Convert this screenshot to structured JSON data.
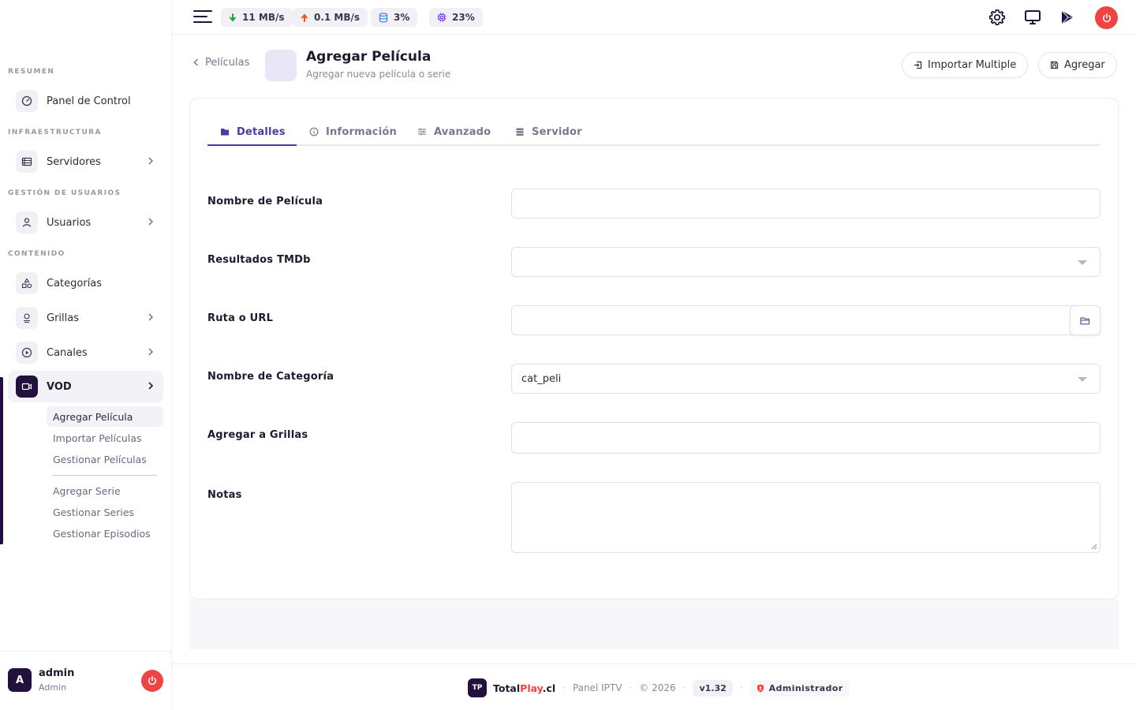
{
  "colors": {
    "primary": "#22113d",
    "accent": "#4a3aa8",
    "danger": "#ef4444",
    "highlight": "#ef4444"
  },
  "topbar": {
    "stats": [
      {
        "icon": "download-arrow-icon",
        "value": "11 MB/s",
        "color": "#16a34a"
      },
      {
        "icon": "upload-arrow-icon",
        "value": "0.1 MB/s",
        "color": "#ea580c"
      },
      {
        "icon": "database-icon",
        "value": "3%",
        "color": "#3b82f6"
      },
      {
        "icon": "cpu-icon",
        "value": "23%",
        "color": "#7c3aed"
      }
    ],
    "icons": [
      "gear-icon",
      "monitor-icon",
      "play-store-icon",
      "power-icon"
    ]
  },
  "sidebar": {
    "sections": [
      {
        "title": "RESUMEN"
      },
      {
        "title": "INFRAESTRUCTURA"
      },
      {
        "title": "GESTIÓN DE USUARIOS"
      },
      {
        "title": "CONTENIDO"
      }
    ],
    "items": [
      {
        "label": "Panel de Control",
        "icon": "dashboard-icon"
      },
      {
        "label": "Servidores",
        "icon": "server-icon"
      },
      {
        "label": "Usuarios",
        "icon": "user-icon"
      },
      {
        "label": "Categorías",
        "icon": "categories-icon"
      },
      {
        "label": "Grillas",
        "icon": "grid-icon"
      },
      {
        "label": "Canales",
        "icon": "play-circle-icon"
      },
      {
        "label": "VOD",
        "icon": "video-icon"
      }
    ],
    "vod_submenu": [
      "Agregar Película",
      "Importar Películas",
      "Gestionar Películas",
      "Agregar Serie",
      "Gestionar Series",
      "Gestionar Episodios"
    ],
    "user": {
      "initial": "A",
      "name": "admin",
      "role": "Admin"
    }
  },
  "header": {
    "back_label": "Películas",
    "title": "Agregar Película",
    "subtitle": "Agregar nueva película o serie",
    "import_button": "Importar Multiple",
    "add_button": "Agregar"
  },
  "tabs": [
    {
      "label": "Detalles",
      "icon": "film-icon",
      "active": true
    },
    {
      "label": "Información",
      "icon": "info-icon",
      "active": false
    },
    {
      "label": "Avanzado",
      "icon": "sliders-icon",
      "active": false
    },
    {
      "label": "Servidor",
      "icon": "server-icon",
      "active": false
    }
  ],
  "form": {
    "fields": [
      {
        "label": "Nombre de Película",
        "value": ""
      },
      {
        "label": "Resultados TMDb",
        "value": ""
      },
      {
        "label": "Ruta o URL",
        "value": ""
      },
      {
        "label": "Nombre de Categoría",
        "value": "cat_peli"
      },
      {
        "label": "Agregar a Grillas",
        "value": ""
      },
      {
        "label": "Notas",
        "value": ""
      }
    ]
  },
  "footer": {
    "logo_text": "TP",
    "brand_prefix": "Total",
    "brand_highlight": "Play",
    "brand_suffix": ".cl",
    "panel_label": "Panel IPTV",
    "copyright": "© 2026",
    "version": "v1.32",
    "role": "Administrador"
  }
}
